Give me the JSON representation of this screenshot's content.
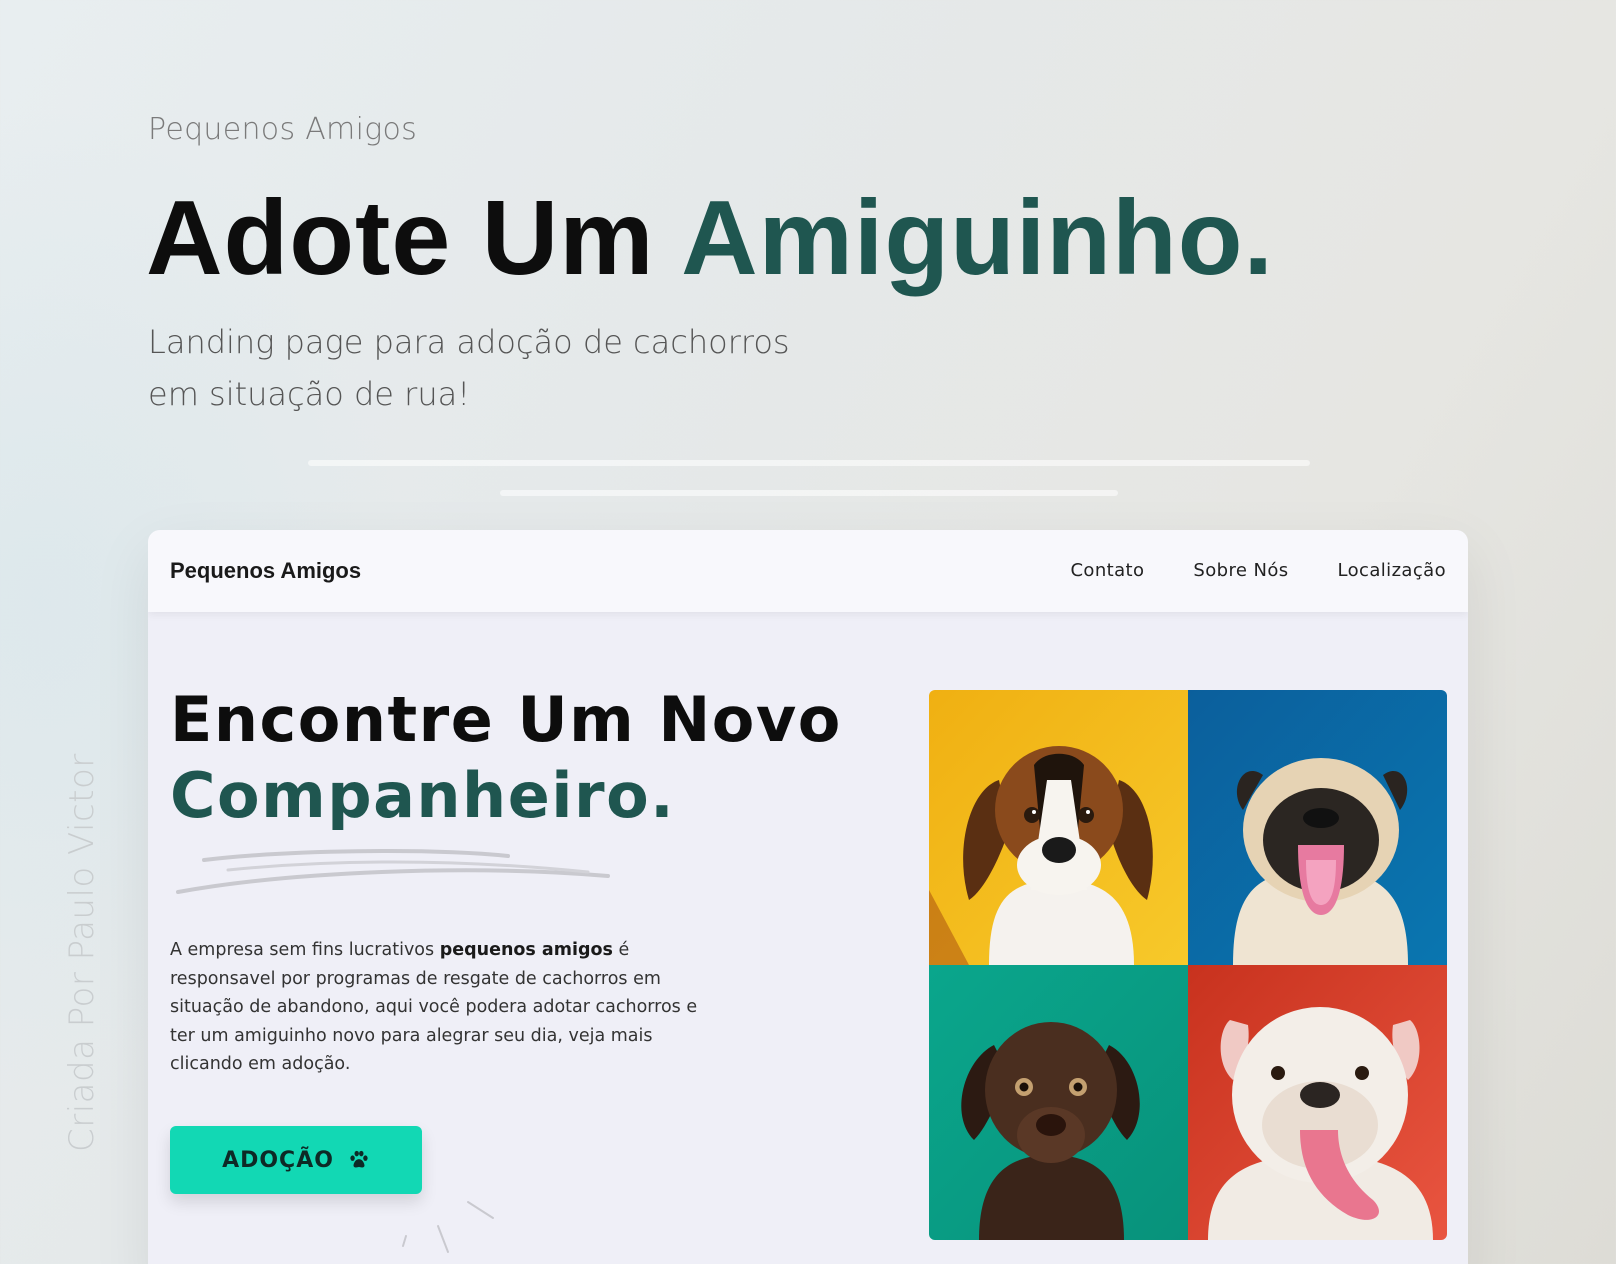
{
  "showcase": {
    "eyebrow": "Pequenos Amigos",
    "title_main": "Adote Um",
    "title_accent": "Amiguinho.",
    "subtitle": "Landing page para adoção de cachorros em situação de rua!",
    "credit": "Criada Por Paulo Victor"
  },
  "site": {
    "brand": "Pequenos Amigos",
    "nav": [
      "Contato",
      "Sobre Nós",
      "Localização"
    ],
    "headline_main": "Encontre Um Novo",
    "headline_accent": "Companheiro.",
    "description": {
      "before": "A empresa sem fins lucrativos ",
      "bold": "pequenos amigos",
      "after": " é responsavel por programas de resgate de cachorros em situação de abandono, aqui você podera adotar cachorros e ter um amiguinho novo para alegrar seu dia, veja mais clicando em adoção."
    },
    "cta_label": "ADOÇÃO",
    "cta_icon": "paw-icon",
    "photos": [
      {
        "name": "beagle-puppy-photo",
        "background": "#f3b81a"
      },
      {
        "name": "pug-photo",
        "background": "#0e6aa8"
      },
      {
        "name": "labrador-puppy-photo",
        "background": "#0aa58a"
      },
      {
        "name": "bulldog-photo",
        "background": "#d8402e"
      }
    ]
  },
  "colors": {
    "accent_dark_green": "#1f5650",
    "button_teal": "#12d8b4"
  }
}
